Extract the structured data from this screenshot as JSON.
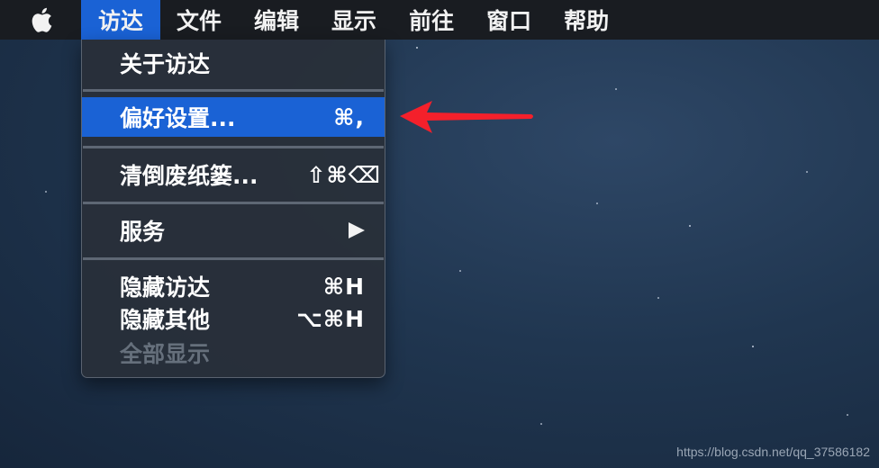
{
  "menubar": {
    "apple_icon": "apple-icon",
    "menus": [
      {
        "label": "访达",
        "active": true
      },
      {
        "label": "文件"
      },
      {
        "label": "编辑"
      },
      {
        "label": "显示"
      },
      {
        "label": "前往"
      },
      {
        "label": "窗口"
      },
      {
        "label": "帮助"
      }
    ]
  },
  "dropdown": {
    "items": [
      {
        "label": "关于访达",
        "shortcut": ""
      },
      {
        "label": "偏好设置...",
        "shortcut": "⌘,",
        "highlighted": true
      },
      {
        "label": "清倒废纸篓...",
        "shortcut": "⇧⌘⌫"
      },
      {
        "label": "服务",
        "submenu": true
      },
      {
        "label": "隐藏访达",
        "shortcut": "⌘H"
      },
      {
        "label": "隐藏其他",
        "shortcut": "⌥⌘H"
      },
      {
        "label": "全部显示",
        "shortcut": "",
        "disabled": true
      }
    ]
  },
  "annotation": {
    "color": "#f4202b"
  },
  "colors": {
    "accent": "#1a62d5",
    "menubar": "#191c21",
    "menu_bg": "#28303a"
  },
  "watermark": "https://blog.csdn.net/qq_37586182"
}
